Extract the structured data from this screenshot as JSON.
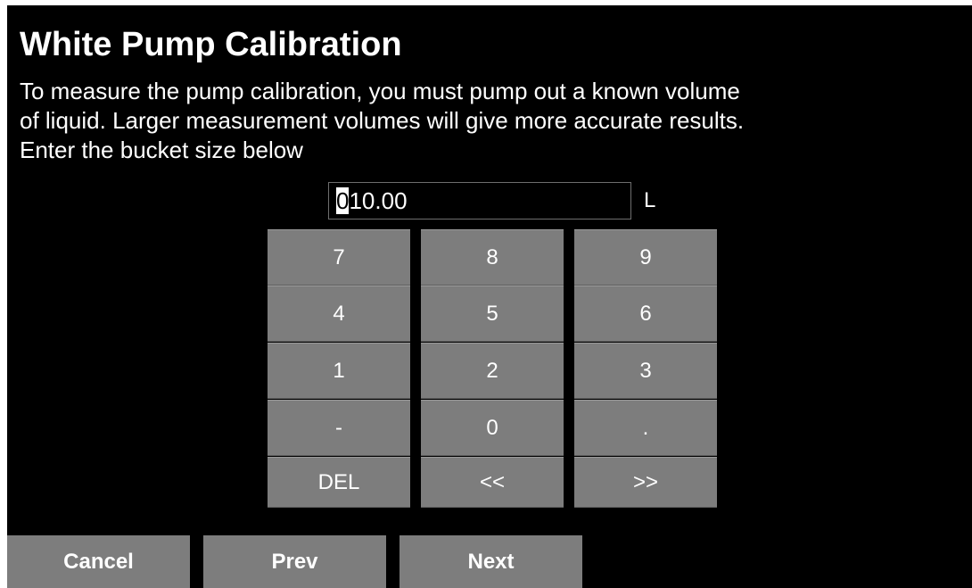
{
  "screen": {
    "title": "White Pump Calibration",
    "instructions": [
      "To measure the pump calibration, you must pump out a known volume",
      "of liquid. Larger measurement volumes will give more accurate results.",
      "Enter the bucket size below"
    ]
  },
  "entry": {
    "cursor_char": "0",
    "value_rest": "10.00",
    "unit": "L"
  },
  "keypad": {
    "keys": [
      "7",
      "8",
      "9",
      "4",
      "5",
      "6",
      "1",
      "2",
      "3",
      "-",
      "0",
      ".",
      "DEL",
      "<<",
      ">>"
    ]
  },
  "nav": {
    "cancel_label": "Cancel",
    "prev_label": "Prev",
    "next_label": "Next"
  },
  "colors": {
    "background": "#000000",
    "button": "#7d7d7d",
    "text": "#ffffff"
  }
}
